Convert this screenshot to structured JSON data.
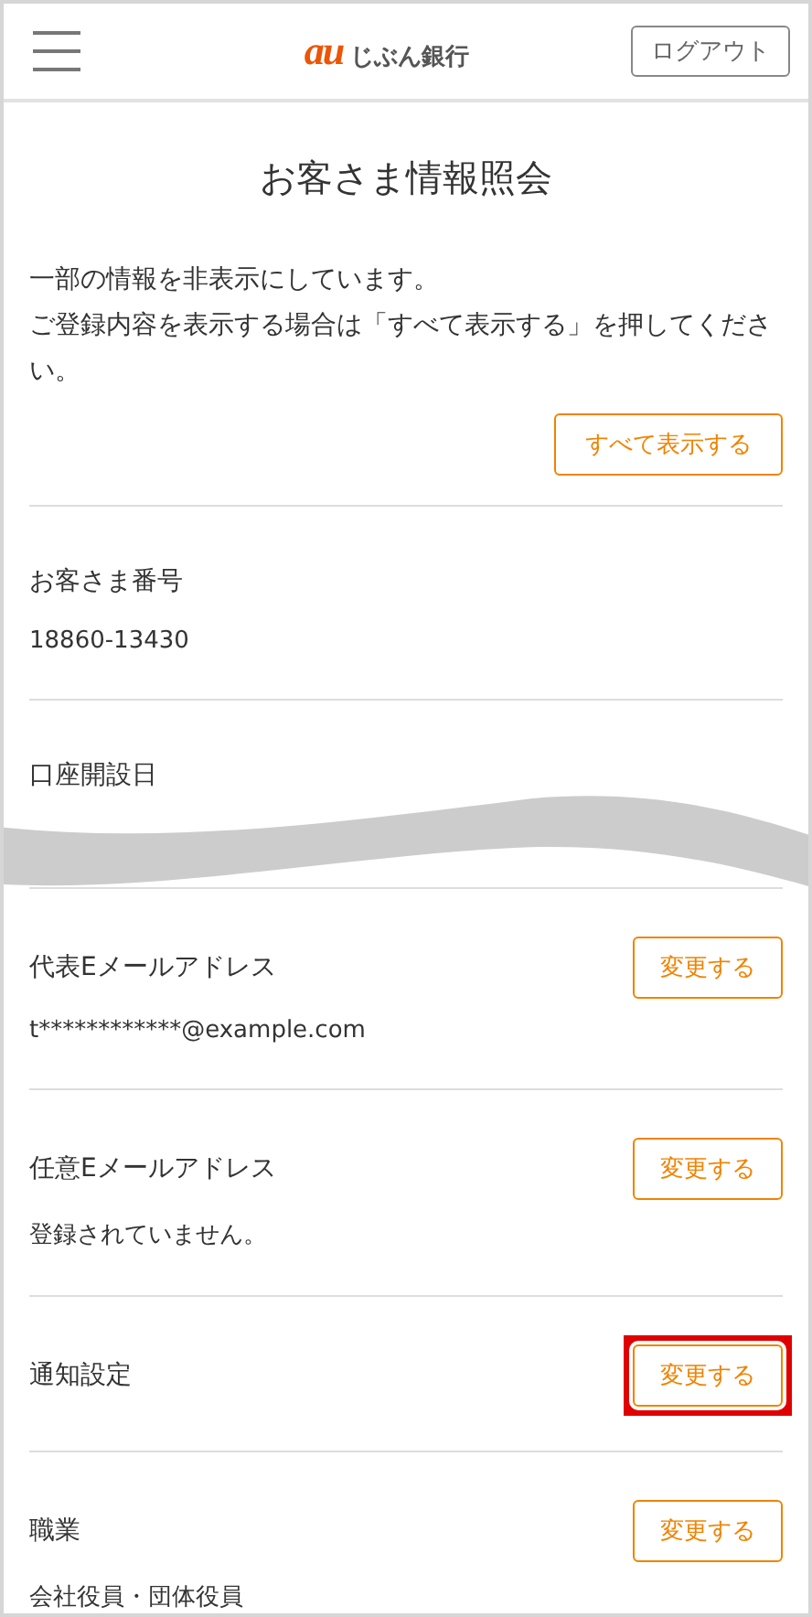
{
  "header": {
    "logo_mark": "au",
    "logo_text": "じぶん銀行",
    "logout_button": "ログアウト"
  },
  "title": "お客さま情報照会",
  "notice": {
    "lines": [
      "一部の情報を非表示にしています。",
      "ご登録内容を表示する場合は「すべて表示する」を押してください。"
    ],
    "button": "すべて表示する"
  },
  "rows": [
    {
      "label": "お客さま番号",
      "value": "18860-13430",
      "highlighted": false
    },
    {
      "label": "口座開設日",
      "highlighted": false,
      "cut": true
    },
    {
      "label": "代表Eメールアドレス",
      "value": "t************@example.com",
      "button": "変更する",
      "highlighted": false
    },
    {
      "label": "任意Eメールアドレス",
      "value": "登録されていません。",
      "button": "変更する",
      "highlighted": false
    },
    {
      "label": "通知設定",
      "button": "変更する",
      "highlighted": true
    },
    {
      "label": "職業",
      "value": "会社役員・団体役員",
      "button": "変更する",
      "highlighted": false
    }
  ]
}
